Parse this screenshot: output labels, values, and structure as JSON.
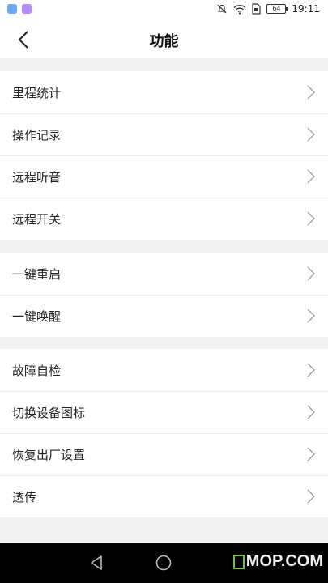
{
  "status_bar": {
    "time": "19:11",
    "battery": "64",
    "app_badge_colors": [
      "#6aa8ff",
      "#b48cff"
    ],
    "icons": [
      "notification-off-icon",
      "wifi-icon",
      "sim-card-icon",
      "battery-icon"
    ]
  },
  "header": {
    "title": "功能",
    "back_icon": "chevron-left-icon"
  },
  "groups": [
    {
      "items": [
        {
          "label": "里程统计"
        },
        {
          "label": "操作记录"
        },
        {
          "label": "远程听音"
        },
        {
          "label": "远程开关"
        }
      ]
    },
    {
      "items": [
        {
          "label": "一键重启"
        },
        {
          "label": "一键唤醒"
        }
      ]
    },
    {
      "items": [
        {
          "label": "故障自检"
        },
        {
          "label": "切换设备图标"
        },
        {
          "label": "恢复出厂设置"
        },
        {
          "label": "透传"
        }
      ]
    }
  ],
  "nav_bar": {
    "icons": [
      "triangle-back-icon",
      "circle-home-icon"
    ]
  },
  "watermark": {
    "text": "MOP.COM",
    "color": "#7bc043"
  },
  "colors": {
    "background": "#f2f2f2",
    "surface": "#ffffff",
    "divider": "#ececec",
    "text": "#222222",
    "chevron": "#9a9a9a",
    "nav_bar": "#000000"
  }
}
